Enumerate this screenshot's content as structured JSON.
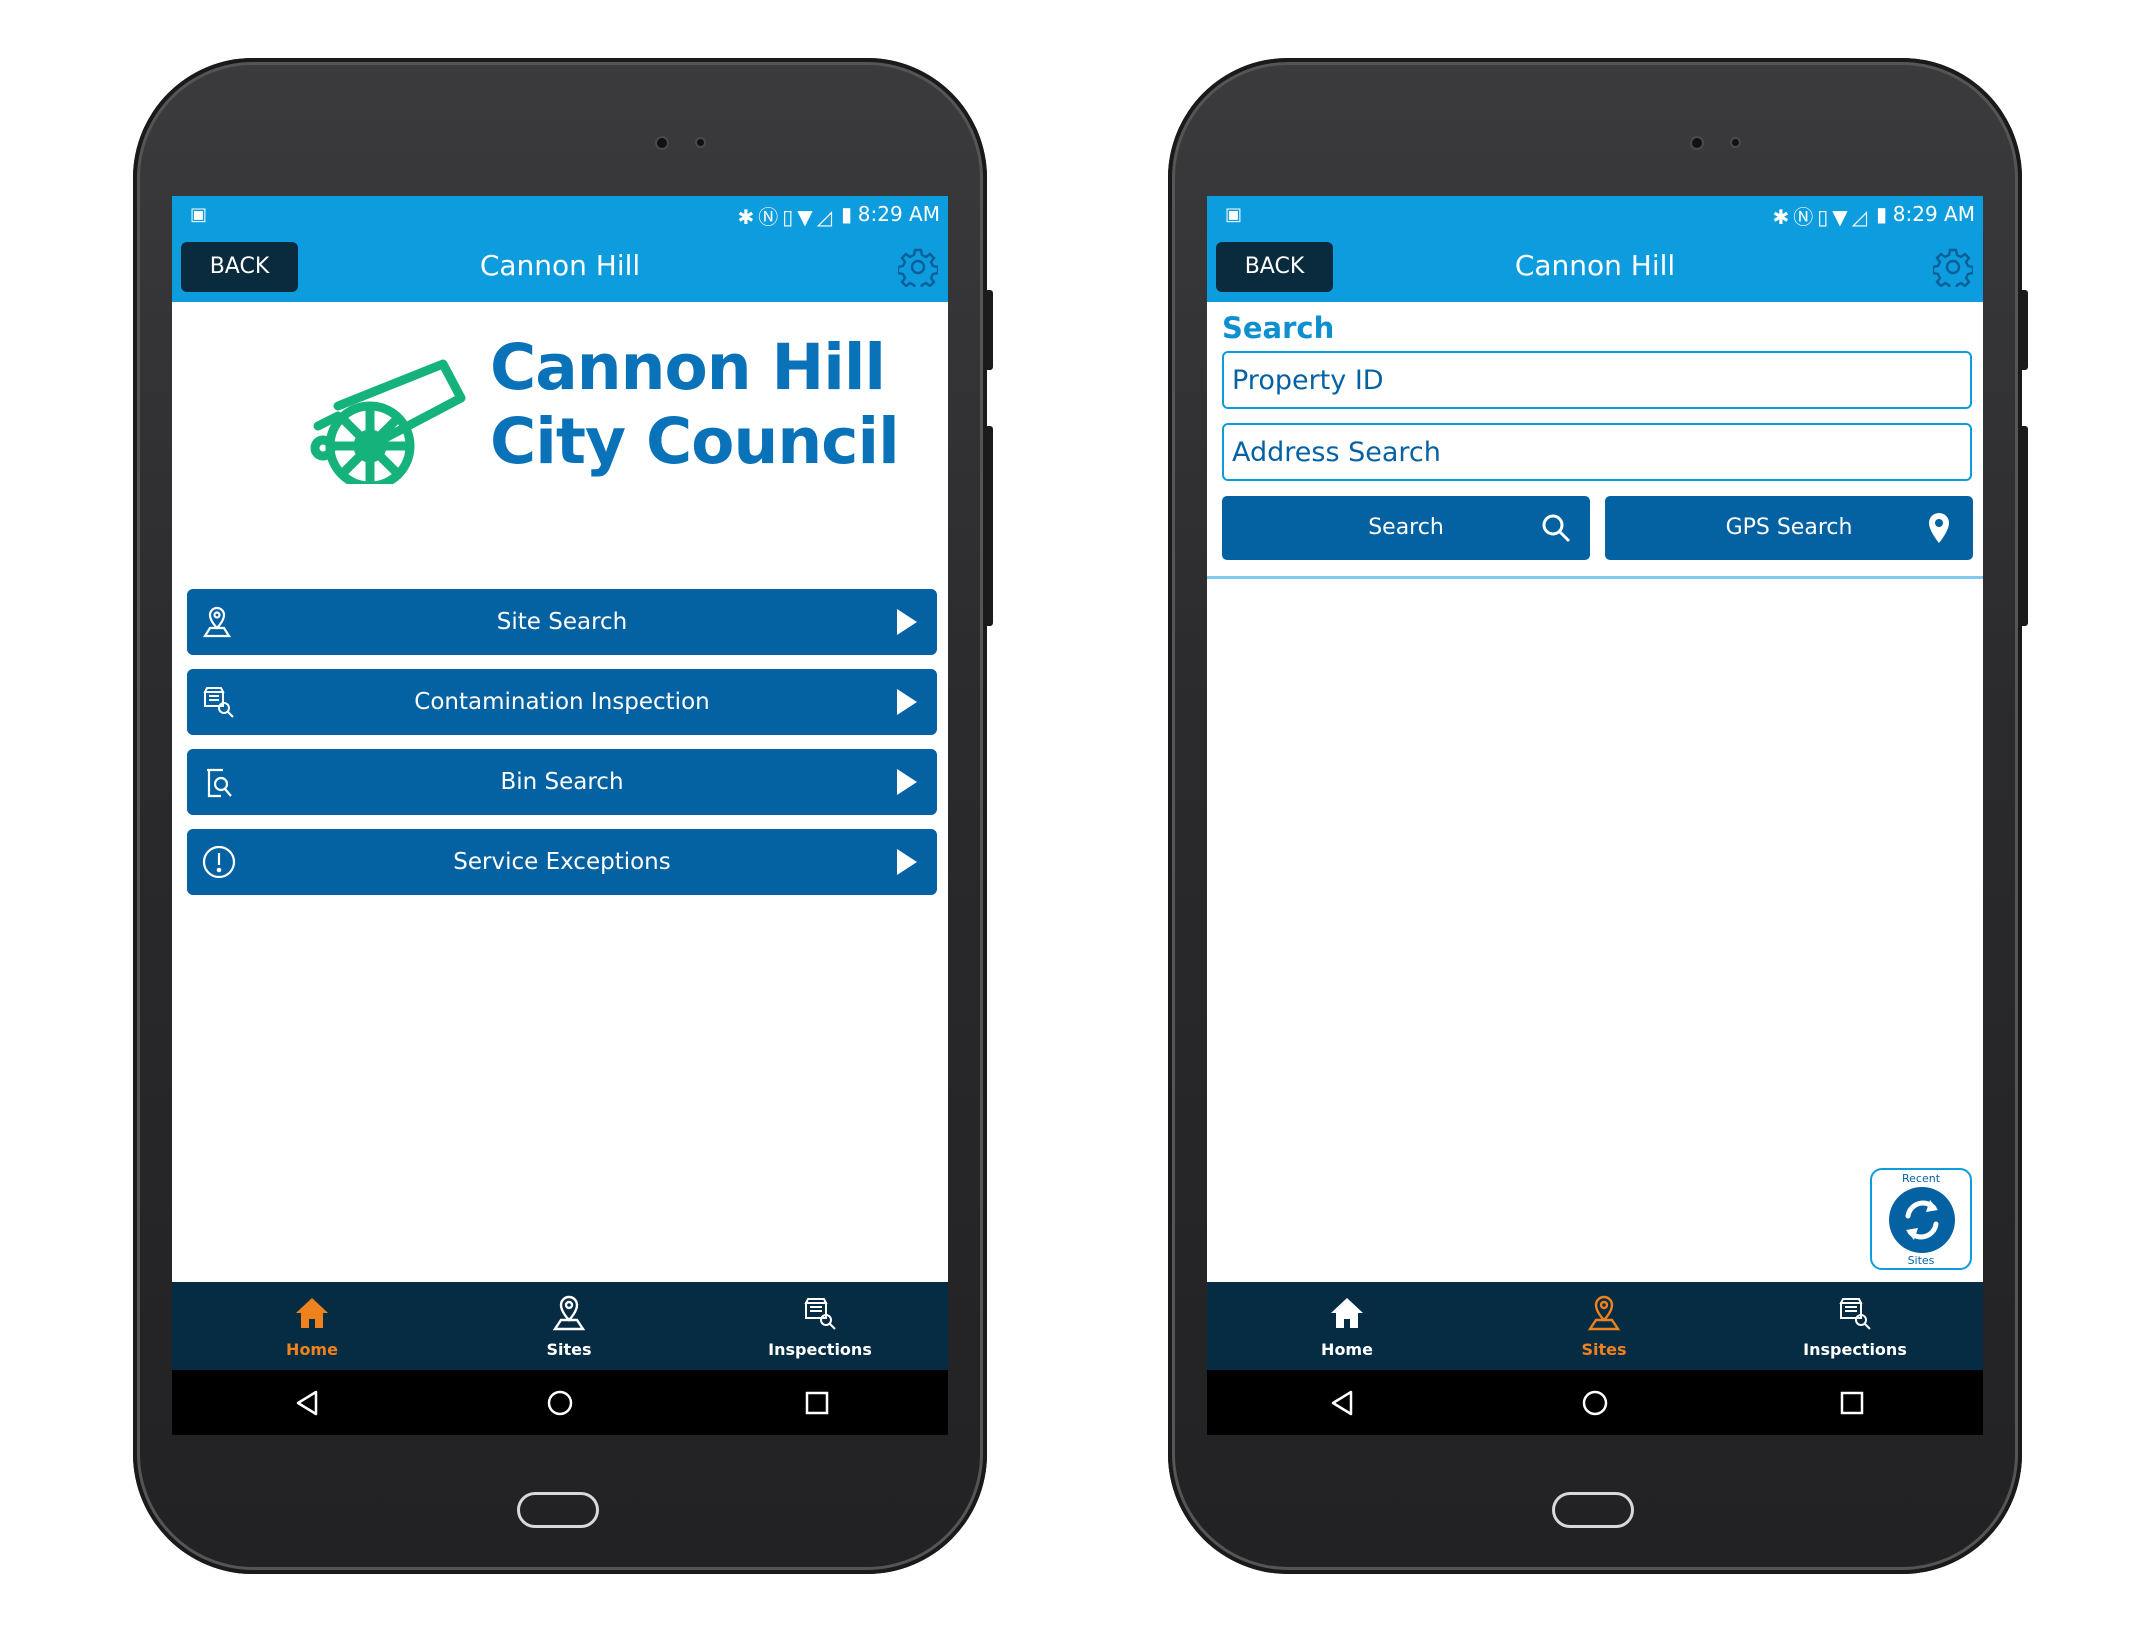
{
  "status_bar": {
    "time": "8:29 AM"
  },
  "app": {
    "back_label": "BACK",
    "title": "Cannon Hill"
  },
  "home_screen": {
    "logo": {
      "line1": "Cannon Hill",
      "line2": "City Council"
    },
    "menu": [
      {
        "label": "Site Search",
        "icon": "map-pin-person-icon"
      },
      {
        "label": "Contamination Inspection",
        "icon": "inspection-icon"
      },
      {
        "label": "Bin Search",
        "icon": "bin-search-icon"
      },
      {
        "label": "Service Exceptions",
        "icon": "exclamation-icon"
      }
    ]
  },
  "search_screen": {
    "heading": "Search",
    "property_id_placeholder": "Property ID",
    "address_placeholder": "Address Search",
    "search_button": "Search",
    "gps_button": "GPS Search",
    "recent": {
      "top_label": "Recent",
      "bottom_label": "Sites"
    }
  },
  "bottom_nav": {
    "home": "Home",
    "sites": "Sites",
    "inspections": "Inspections"
  },
  "colors": {
    "appbar": "#0d9cdd",
    "primary": "#0462a3",
    "nav_bg": "#062c43",
    "active_tab": "#f0821e",
    "logo_green": "#15b27c",
    "logo_text": "#0a72b9"
  }
}
